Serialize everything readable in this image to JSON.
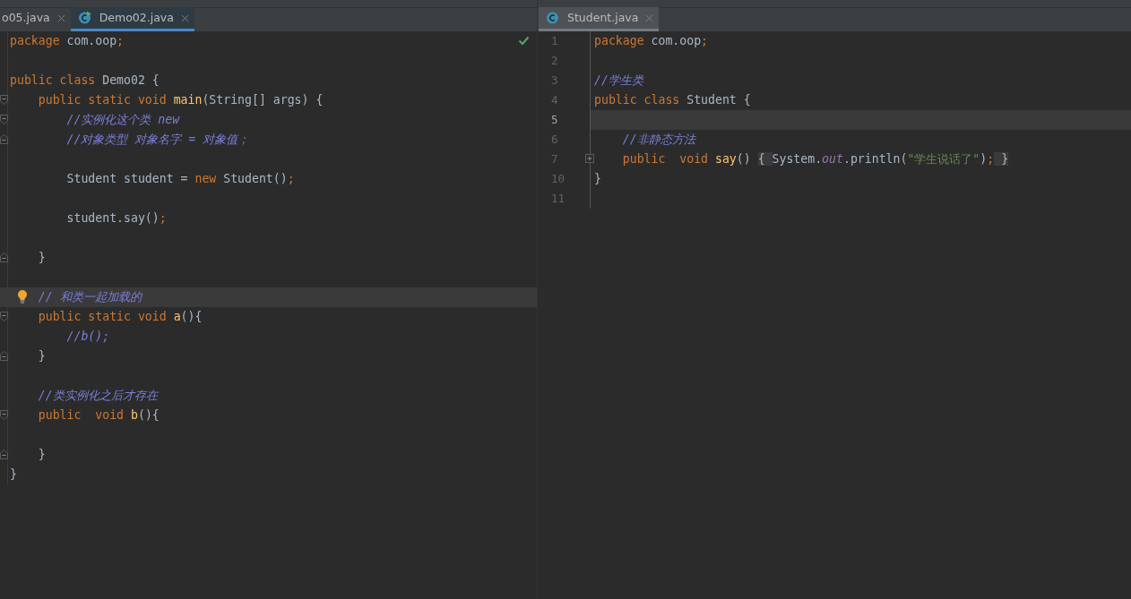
{
  "panes": [
    {
      "focused": true,
      "tabs": [
        {
          "label": "o05.java",
          "selected": false
        },
        {
          "label": "Demo02.java",
          "selected": true,
          "kind": "runnable"
        }
      ],
      "lines": [
        {
          "current": false,
          "tokens": [
            {
              "kind": "keyword",
              "text": "package"
            },
            {
              "kind": "plain",
              "text": " com.oop"
            },
            {
              "kind": "keyword",
              "text": ";"
            }
          ]
        },
        {
          "current": false
        },
        {
          "current": false,
          "tokens": [
            {
              "kind": "keyword",
              "text": "public class "
            },
            {
              "kind": "plain",
              "text": "Demo02 {"
            }
          ]
        },
        {
          "current": false,
          "fold_open": true,
          "tokens": [
            {
              "kind": "keyword",
              "text": "    public static void "
            },
            {
              "kind": "method",
              "text": "main"
            },
            {
              "kind": "plain",
              "text": "(String[] args) {"
            }
          ]
        },
        {
          "current": false,
          "fold_open": true,
          "tokens": [
            {
              "kind": "comment",
              "text": "        //实例化这个类 new"
            }
          ]
        },
        {
          "current": false,
          "fold_close": true,
          "tokens": [
            {
              "kind": "comment",
              "text": "        //对象类型 对象名字 = 对象值；"
            }
          ]
        },
        {
          "current": false
        },
        {
          "current": false,
          "tokens": [
            {
              "kind": "plain",
              "text": "        Student student = "
            },
            {
              "kind": "keyword",
              "text": "new "
            },
            {
              "kind": "plain",
              "text": "Student()"
            },
            {
              "kind": "keyword",
              "text": ";"
            }
          ]
        },
        {
          "current": false
        },
        {
          "current": false,
          "tokens": [
            {
              "kind": "plain",
              "text": "        student.say()"
            },
            {
              "kind": "keyword",
              "text": ";"
            }
          ]
        },
        {
          "current": false
        },
        {
          "current": false,
          "fold_close": true,
          "tokens": [
            {
              "kind": "plain",
              "text": "    }"
            }
          ]
        },
        {
          "current": false
        },
        {
          "current": true,
          "bulb": true,
          "tokens": [
            {
              "kind": "comment",
              "text": "    // 和类一起加载的"
            }
          ]
        },
        {
          "current": false,
          "fold_open": true,
          "tokens": [
            {
              "kind": "keyword",
              "text": "    public static void "
            },
            {
              "kind": "method",
              "text": "a"
            },
            {
              "kind": "plain",
              "text": "(){"
            }
          ]
        },
        {
          "current": false,
          "tokens": [
            {
              "kind": "comment",
              "text": "        //b();"
            }
          ]
        },
        {
          "current": false,
          "fold_close": true,
          "tokens": [
            {
              "kind": "plain",
              "text": "    }"
            }
          ]
        },
        {
          "current": false
        },
        {
          "current": false,
          "tokens": [
            {
              "kind": "comment",
              "text": "    //类实例化之后才存在"
            }
          ]
        },
        {
          "current": false,
          "fold_open": true,
          "tokens": [
            {
              "kind": "keyword",
              "text": "    public  void "
            },
            {
              "kind": "method",
              "text": "b"
            },
            {
              "kind": "plain",
              "text": "(){"
            }
          ]
        },
        {
          "current": false
        },
        {
          "current": false,
          "fold_close": true,
          "tokens": [
            {
              "kind": "plain",
              "text": "    }"
            }
          ]
        },
        {
          "current": false,
          "tokens": [
            {
              "kind": "plain",
              "text": "}"
            }
          ]
        }
      ]
    },
    {
      "focused": false,
      "tabs": [
        {
          "label": "Student.java",
          "selected": true,
          "kind": "class"
        }
      ],
      "lines": [
        {
          "number": "1",
          "current": false,
          "tokens": [
            {
              "kind": "keyword",
              "text": "package"
            },
            {
              "kind": "plain",
              "text": " com.oop"
            },
            {
              "kind": "keyword",
              "text": ";"
            }
          ]
        },
        {
          "number": "2",
          "current": false
        },
        {
          "number": "3",
          "current": false,
          "tokens": [
            {
              "kind": "comment",
              "text": "//学生类"
            }
          ]
        },
        {
          "number": "4",
          "current": false,
          "tokens": [
            {
              "kind": "keyword",
              "text": "public class "
            },
            {
              "kind": "plain",
              "text": "Student {"
            }
          ]
        },
        {
          "number": "5",
          "current": true
        },
        {
          "number": "6",
          "current": false,
          "tokens": [
            {
              "kind": "comment",
              "text": "    //非静态方法"
            }
          ]
        },
        {
          "number": "7",
          "current": false,
          "collapsed": true,
          "tokens": [
            {
              "kind": "keyword",
              "text": "    public  void "
            },
            {
              "kind": "method",
              "text": "say"
            },
            {
              "kind": "plain",
              "text": "() "
            },
            {
              "kind": "folded",
              "text": "{ "
            },
            {
              "kind": "plain",
              "text": "System."
            },
            {
              "kind": "field",
              "text": "out"
            },
            {
              "kind": "plain",
              "text": ".println("
            },
            {
              "kind": "string",
              "text": "\"学生说话了\""
            },
            {
              "kind": "plain",
              "text": ")"
            },
            {
              "kind": "keyword",
              "text": ";"
            },
            {
              "kind": "folded",
              "text": " }"
            }
          ]
        },
        {
          "number": "10",
          "current": false,
          "tokens": [
            {
              "kind": "plain",
              "text": "}"
            }
          ]
        },
        {
          "number": "11",
          "current": false
        }
      ]
    }
  ]
}
